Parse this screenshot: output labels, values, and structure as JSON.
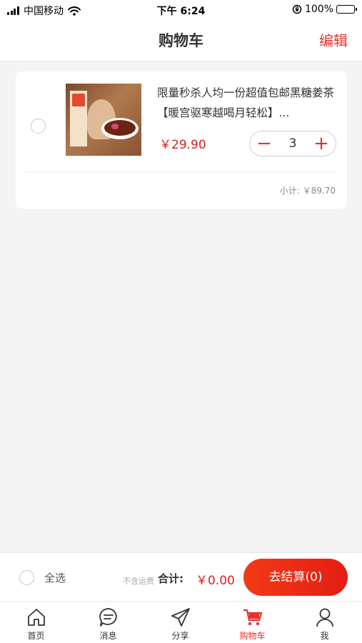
{
  "status_bar": {
    "carrier": "中国移动",
    "time": "下午 6:24",
    "battery": "100%",
    "icons": [
      "signal-icon",
      "wifi-icon",
      "orientation-lock-icon",
      "battery-icon"
    ]
  },
  "header": {
    "title": "购物车",
    "edit_label": "编辑"
  },
  "cart": {
    "items": [
      {
        "title": "限量秒杀人均一份超值包邮黑糖姜茶【暖宫驱寒越喝月轻松】...",
        "price": "￥29.90",
        "quantity": "3",
        "minus_symbol": "−",
        "plus_symbol": "+",
        "subtotal": "小计: ￥89.70",
        "selected": false
      }
    ]
  },
  "checkout": {
    "select_all_label": "全选",
    "shipping_note": "不含运费",
    "total_label": "合计:",
    "total_value": "￥0.00",
    "checkout_button": "去结算(0)"
  },
  "tabs": [
    {
      "label": "首页",
      "icon": "home-icon",
      "active": false
    },
    {
      "label": "消息",
      "icon": "message-icon",
      "active": false
    },
    {
      "label": "分享",
      "icon": "share-icon",
      "active": false
    },
    {
      "label": "购物车",
      "icon": "cart-icon",
      "active": true
    },
    {
      "label": "我",
      "icon": "user-icon",
      "active": false
    }
  ],
  "colors": {
    "accent": "#e8302c",
    "price": "#d81e1e",
    "background": "#f4f4f4"
  }
}
